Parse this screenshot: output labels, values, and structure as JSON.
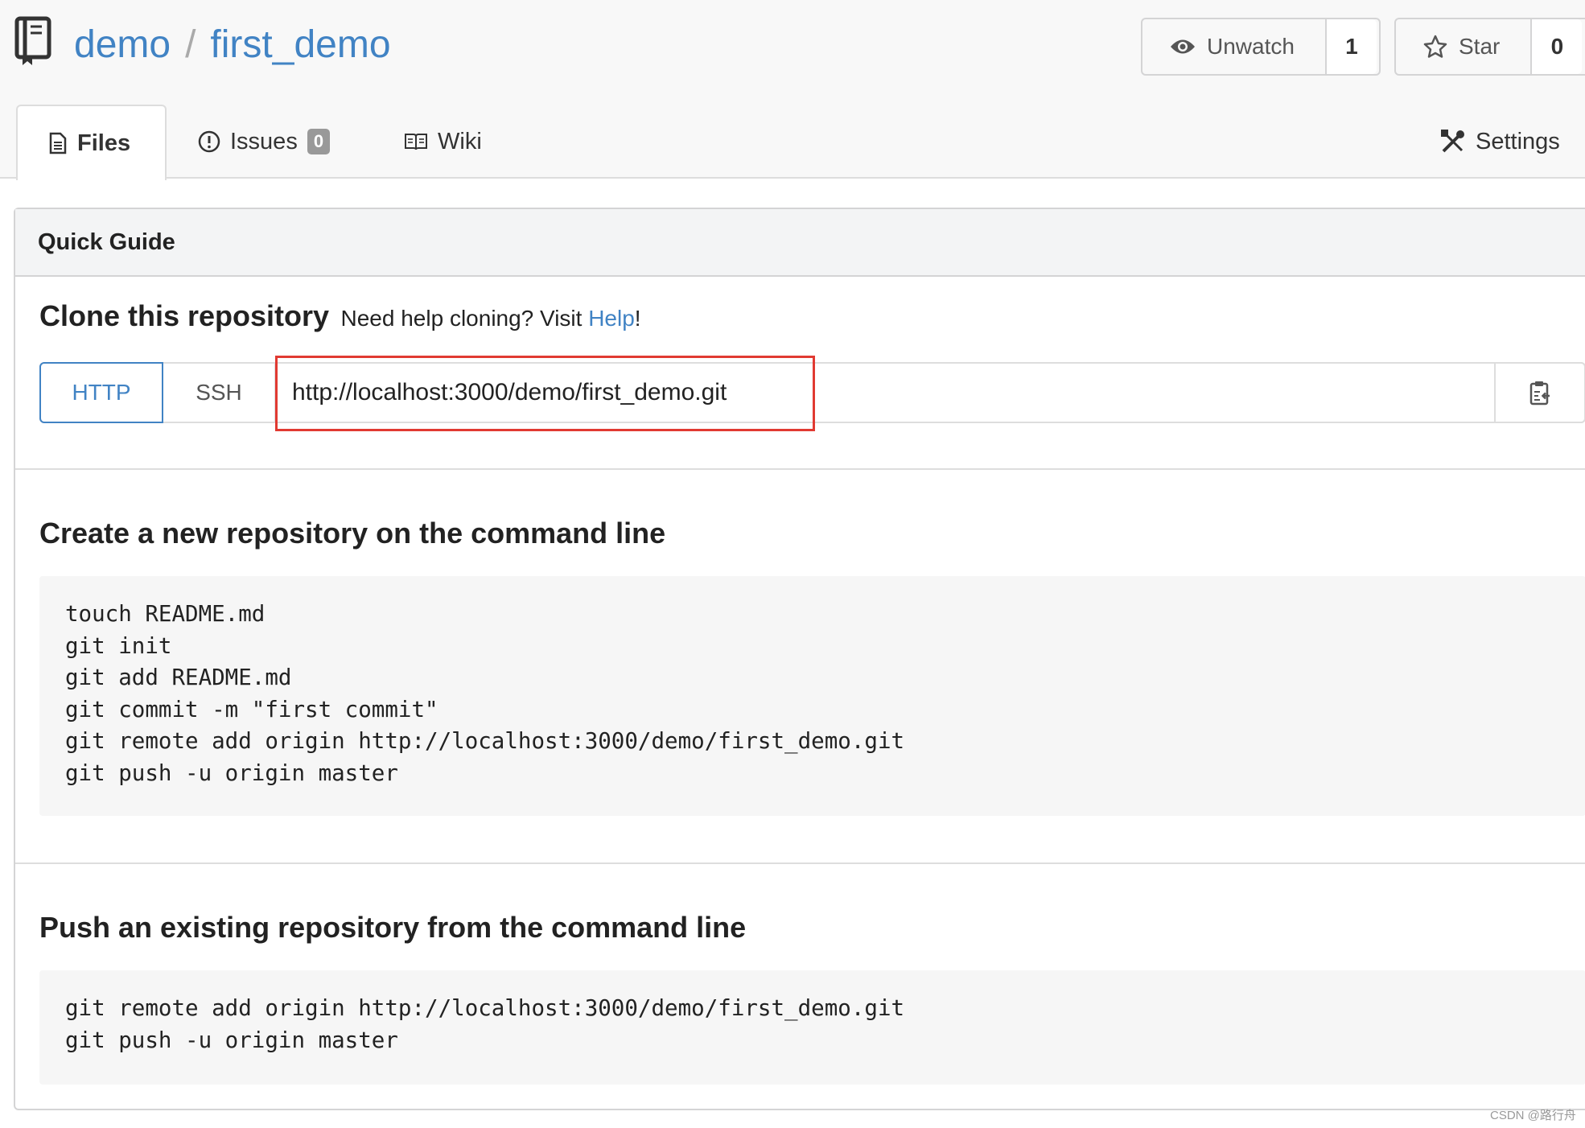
{
  "repo": {
    "owner": "demo",
    "separator": "/",
    "name": "first_demo"
  },
  "actions": {
    "unwatch": {
      "label": "Unwatch",
      "count": "1"
    },
    "star": {
      "label": "Star",
      "count": "0"
    }
  },
  "tabs": {
    "files": "Files",
    "issues": "Issues",
    "issues_count": "0",
    "wiki": "Wiki",
    "settings": "Settings"
  },
  "guide": {
    "header": "Quick Guide",
    "clone_title": "Clone this repository",
    "clone_help_prefix": "Need help cloning? Visit ",
    "clone_help_link": "Help",
    "clone_help_suffix": "!",
    "protocols": [
      "HTTP",
      "SSH"
    ],
    "clone_url": "http://localhost:3000/demo/first_demo.git",
    "create_title": "Create a new repository on the command line",
    "create_lines": [
      "touch README.md",
      "git init",
      "git add README.md",
      "git commit -m \"first commit\"",
      "git remote add origin http://localhost:3000/demo/first_demo.git",
      "git push -u origin master"
    ],
    "push_title": "Push an existing repository from the command line",
    "push_lines": [
      "git remote add origin http://localhost:3000/demo/first_demo.git",
      "git push -u origin master"
    ]
  },
  "watermark": "CSDN @路行舟",
  "colors": {
    "link": "#4183c4",
    "highlight": "#e13a32"
  }
}
